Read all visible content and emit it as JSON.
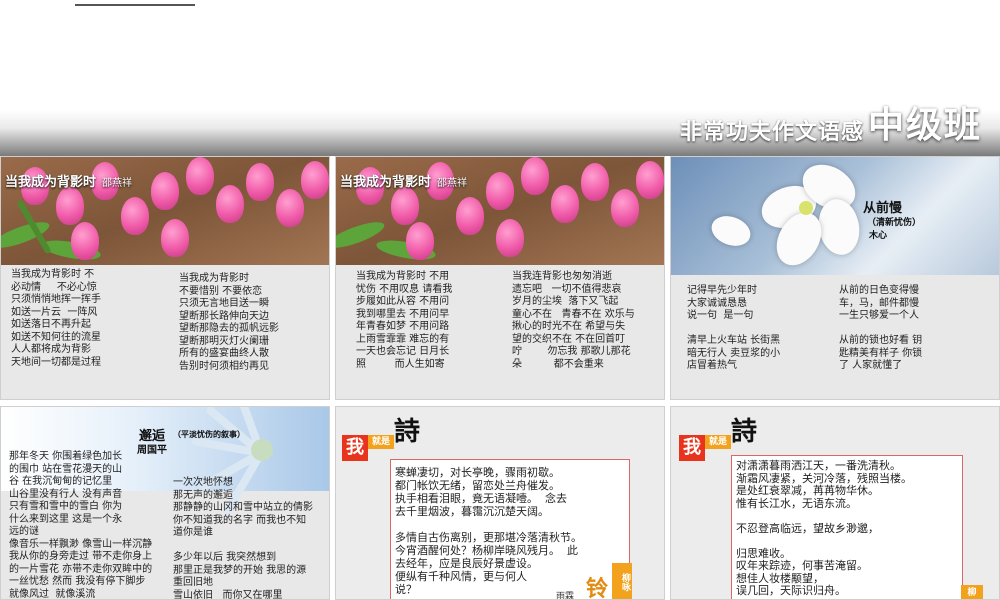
{
  "header": {
    "subtitle": "非常功夫作文语感",
    "title": "中级班"
  },
  "card1": {
    "title": "当我成为背影时",
    "author": "邵燕祥",
    "left": "当我成为背影时 不\n必动情     不必心惊\n只须悄悄地挥一挥手\n如送一片云  一阵风\n如送落日不再升起\n如送不知何往的流星\n人人都将成为背影\n天地间一切都是过程",
    "right": "当我成为背影时\n不要惜别 不要依恋\n只须无言地目送一瞬\n望断那长路伸向天边\n望断那隐去的孤帆远影\n望断那明灭灯火阑珊\n所有的盛宴曲终人散\n告别时何须相约再见"
  },
  "card2": {
    "title": "当我成为背影时",
    "author": "邵燕祥",
    "left": "当我成为背影时 不用\n忧伤 不用叹息 请看我\n步履如此从容 不用问\n我到哪里去 不用问早\n年青春如梦 不用问路\n上雨雪霏霏 难忘的有\n一天也会忘记 日月长\n照         而人生如寄",
    "right": "当我连背影也匆匆消逝\n遗忘吧   一切不值得悲哀\n岁月的尘埃  落下又飞起\n童心不在   青春不在 欢乐与\n揪心的时光不在 希望与失\n望的交织不在 不在回首叮\n咛        勿忘我 那歌儿那花\n朵          都不会重来"
  },
  "card3": {
    "title": "从前慢",
    "subtitle": "（清新忧伤）",
    "author": "木心",
    "left": "记得早先少年时\n大家诚诚恳恳\n说一句  是一句\n\n清早上火车站 长街黑\n暗无行人 卖豆浆的小\n店冒着热气",
    "right": "从前的日色变得慢\n车，马，邮件都慢\n一生只够爱一个人\n\n从前的锁也好看 钥\n匙精美有样子 你锁\n了 人家就懂了"
  },
  "card4": {
    "title": "邂逅",
    "subtitle": "（平淡忧伤的叙事）",
    "author": "周国平",
    "left": "那年冬天 你围着绿色加长\n的围巾 站在雪花漫天的山\n谷 在我沉甸甸的记忆里\n山谷里没有行人 没有声音\n只有雪和雪中的雪白 你为\n什么来到这里 这是一个永\n远的谜\n像音乐一样飘渺 像雪山一样沉静\n我从你的身旁走过 带不走你身上\n的一片雪花 亦带不走你双眸中的\n一丝忧愁 然而 我没有停下脚步\n就像风过  就像溪流",
    "right": "一次次地怀想\n那无声的邂逅\n那静静的山冈和雪中站立的倩影\n你不知道我的名字 而我也不知\n道你是谁\n\n多少年以后 我突然想到\n那里正是我梦的开始 我思的源\n重回旧地\n雪山依旧   而你又在哪里"
  },
  "card5": {
    "tag_wo": "我",
    "tag_jiushi": "就是",
    "shi": "詩",
    "text": "寒蝉凄切，对长亭晚，骤雨初歇。\n都门帐饮无绪，留恋处兰舟催发。\n执手相看泪眼，竟无语凝噎。  念去\n去千里烟波，暮霭沉沉楚天阔。\n\n多情自古伤离别，更那堪冷落清秋节。\n今宵酒醒何处？杨柳岸晓风残月。  此\n去经年，应是良辰好景虚设。\n便纵有千种风情，更与何人\n说？",
    "side_yulin": "雨霖",
    "side_ling": "铃",
    "side_liuyong": "柳咏"
  },
  "card6": {
    "tag_wo": "我",
    "tag_jiushi": "就是",
    "shi": "詩",
    "text": "对潇潇暮雨洒江天，一番洗清秋。\n渐霜风凄紧，关河冷落，残照当楼。\n是处红衰翠减，苒苒物华休。\n惟有长江水，无语东流。\n\n不忍登高临远，望故乡渺邈，\n\n归思难收。\n叹年来踪迹，何事苦淹留。\n想佳人妆楼颙望，\n误几回，天际识归舟。",
    "side_liu": "柳"
  }
}
